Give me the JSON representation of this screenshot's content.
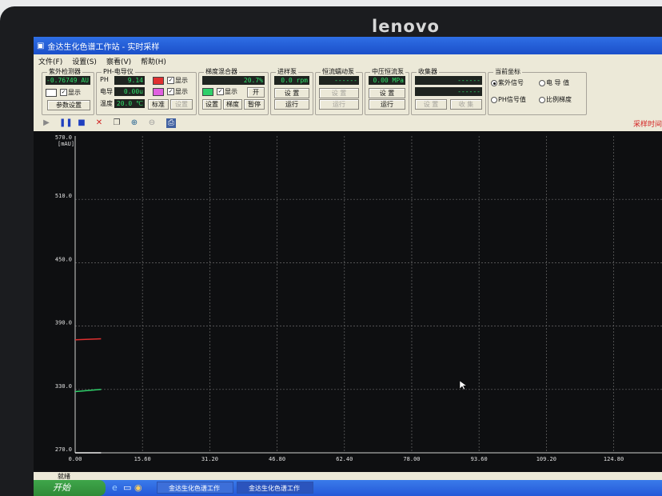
{
  "monitor": {
    "brand": "lenovo"
  },
  "window": {
    "title": "金达生化色谱工作站 - 实时采样"
  },
  "menu": [
    "文件(F)",
    "设置(S)",
    "察看(V)",
    "帮助(H)"
  ],
  "uv_detector": {
    "title": "紫外检测器",
    "value": "-0.76749 AU",
    "show_label": "显示",
    "params_button": "参数设置"
  },
  "ph_meter": {
    "title": "PH-电导仪",
    "ph_label": "PH",
    "ph_value": "9.14",
    "cond_label": "电导",
    "cond_value": "0.00u",
    "temp_label": "温度",
    "temp_value": "20.0 ℃",
    "show_label": "显示",
    "calibrate_button": "标准",
    "setup_button": "设置",
    "ph_color": "#e03030",
    "cond_color": "#e060e0"
  },
  "gradient_mixer": {
    "title": "梯度混合器",
    "value": "20.7%",
    "show_label": "显示",
    "open_button": "开",
    "setup_button": "设置",
    "gradient_button": "梯度",
    "pause_button": "暂停",
    "color": "#2fd06a"
  },
  "feed_pump": {
    "title": "进样泵",
    "value": "0.0 rpm",
    "setup_button": "设 置",
    "run_button": "运行"
  },
  "peristaltic_pump": {
    "title": "恒流蠕动泵",
    "value": "------",
    "setup_button": "设 置",
    "run_button": "运行"
  },
  "medium_pressure_pump": {
    "title": "中压恒流泵",
    "value": "0.00 MPa",
    "setup_button": "设 置",
    "run_button": "运行"
  },
  "collector": {
    "title": "收集器",
    "value1": "------",
    "value2": "------",
    "setup_button": "设 置",
    "collect_button": "收 集"
  },
  "coords": {
    "title": "当前坐标",
    "options": [
      "紫外信号",
      "电 导 值",
      "PH信号值",
      "比例梯度"
    ],
    "selected": "紫外信号"
  },
  "icons": [
    "play-icon",
    "pause-icon",
    "stop-icon",
    "close-icon",
    "copy-icon",
    "zoom-in-icon",
    "zoom-out-icon",
    "print-icon"
  ],
  "sampling_state": "采样时间",
  "chart_data": {
    "type": "line",
    "ylabel": "[mAU]",
    "ylim_top_label": "570.0",
    "y_ticks": [
      "510.0",
      "450.0",
      "390.0",
      "330.0",
      "270.0"
    ],
    "y_values": [
      510,
      450,
      390,
      330,
      270
    ],
    "ylim": [
      270,
      570
    ],
    "x_ticks": [
      "0.00",
      "15.60",
      "31.20",
      "46.80",
      "62.40",
      "78.00",
      "93.60",
      "109.20",
      "124.80"
    ],
    "x_values": [
      0,
      15.6,
      31.2,
      46.8,
      62.4,
      78.0,
      93.6,
      109.2,
      124.8
    ],
    "xlim": [
      0,
      136
    ],
    "grid": true,
    "series": [
      {
        "color": "#e03030",
        "points": [
          [
            0,
            377
          ],
          [
            6,
            378
          ]
        ]
      },
      {
        "color": "#2fd06a",
        "points": [
          [
            0,
            328
          ],
          [
            6,
            330
          ]
        ]
      },
      {
        "color": "#f0f0f0",
        "points": [
          [
            0,
            270
          ],
          [
            6,
            270
          ]
        ]
      }
    ]
  },
  "status_text": "就绪",
  "taskbar": {
    "start": "开始",
    "tasks": [
      "金达生化色谱工作",
      "金达生化色谱工作"
    ]
  }
}
